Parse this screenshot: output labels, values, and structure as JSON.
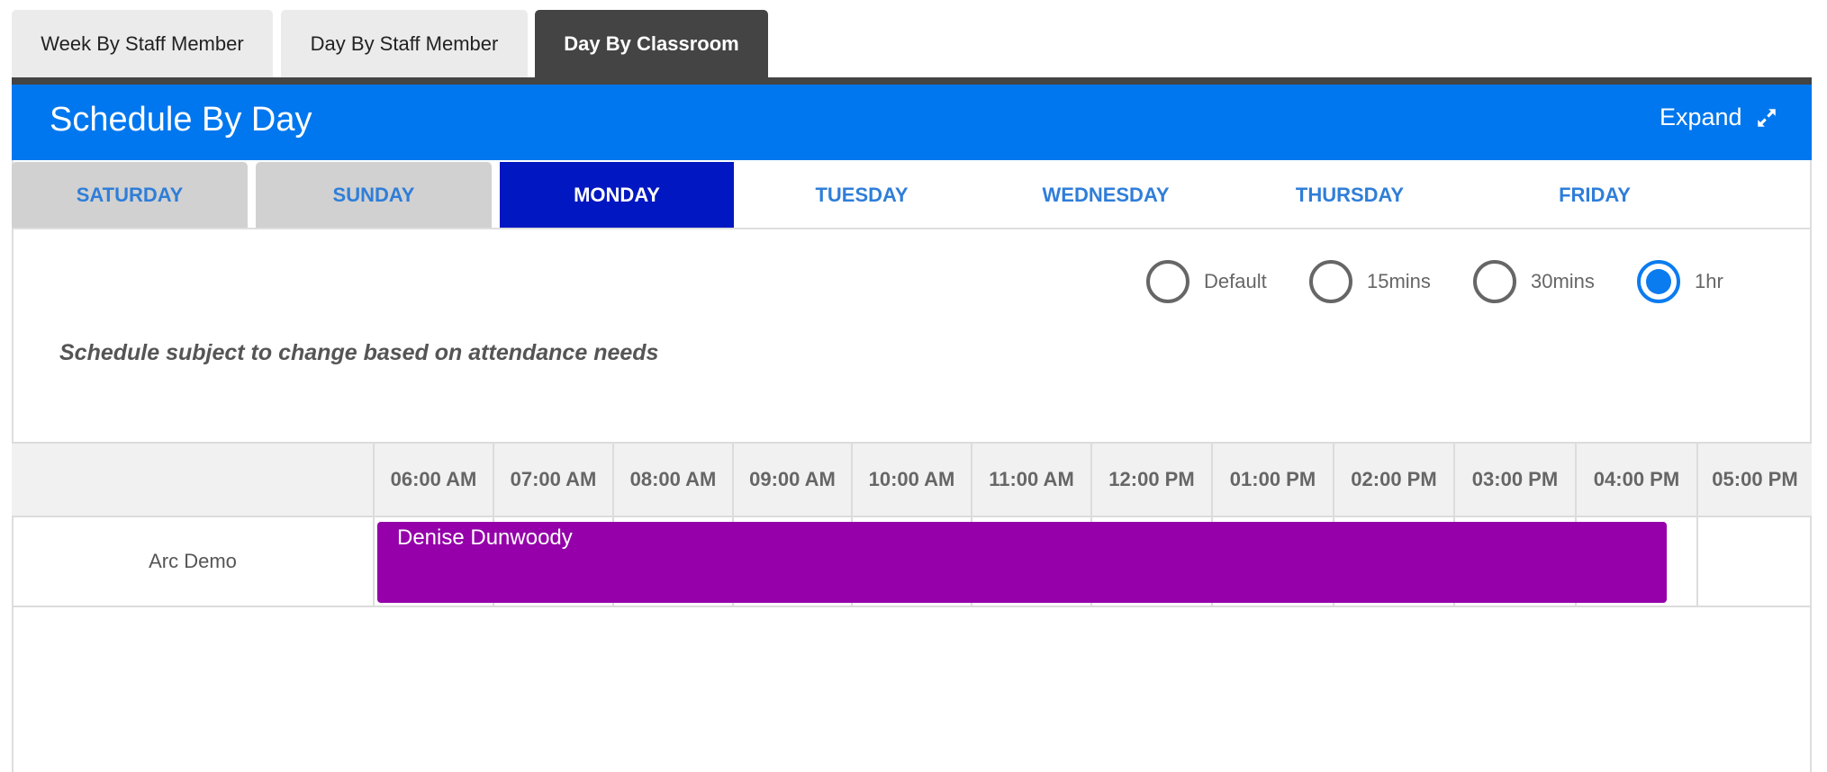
{
  "view_tabs": [
    {
      "label": "Week By Staff Member",
      "active": false
    },
    {
      "label": "Day By Staff Member",
      "active": false
    },
    {
      "label": "Day By Classroom",
      "active": true
    }
  ],
  "header": {
    "title": "Schedule By Day",
    "expand_label": "Expand",
    "expand_icon": "expand-arrows-icon"
  },
  "day_tabs": [
    {
      "label": "SATURDAY",
      "active": false
    },
    {
      "label": "SUNDAY",
      "active": false
    },
    {
      "label": "MONDAY",
      "active": true
    },
    {
      "label": "TUESDAY",
      "active": false
    },
    {
      "label": "WEDNESDAY",
      "active": false
    },
    {
      "label": "THURSDAY",
      "active": false
    },
    {
      "label": "FRIDAY",
      "active": false
    }
  ],
  "interval_options": [
    {
      "label": "Default",
      "checked": false
    },
    {
      "label": "15mins",
      "checked": false
    },
    {
      "label": "30mins",
      "checked": false
    },
    {
      "label": "1hr",
      "checked": true
    }
  ],
  "note": "Schedule subject to change based on attendance needs",
  "schedule": {
    "time_slots": [
      "06:00 AM",
      "07:00 AM",
      "08:00 AM",
      "09:00 AM",
      "10:00 AM",
      "11:00 AM",
      "12:00 PM",
      "01:00 PM",
      "02:00 PM",
      "03:00 PM",
      "04:00 PM",
      "05:00 PM"
    ],
    "rows": [
      {
        "classroom": "Arc Demo",
        "shift": {
          "staff": "Denise Dunwoody",
          "color": "#9500aa"
        }
      }
    ]
  },
  "colors": {
    "accent": "#0077ee",
    "active_day": "#0017c1",
    "active_view_tab": "#444444"
  }
}
